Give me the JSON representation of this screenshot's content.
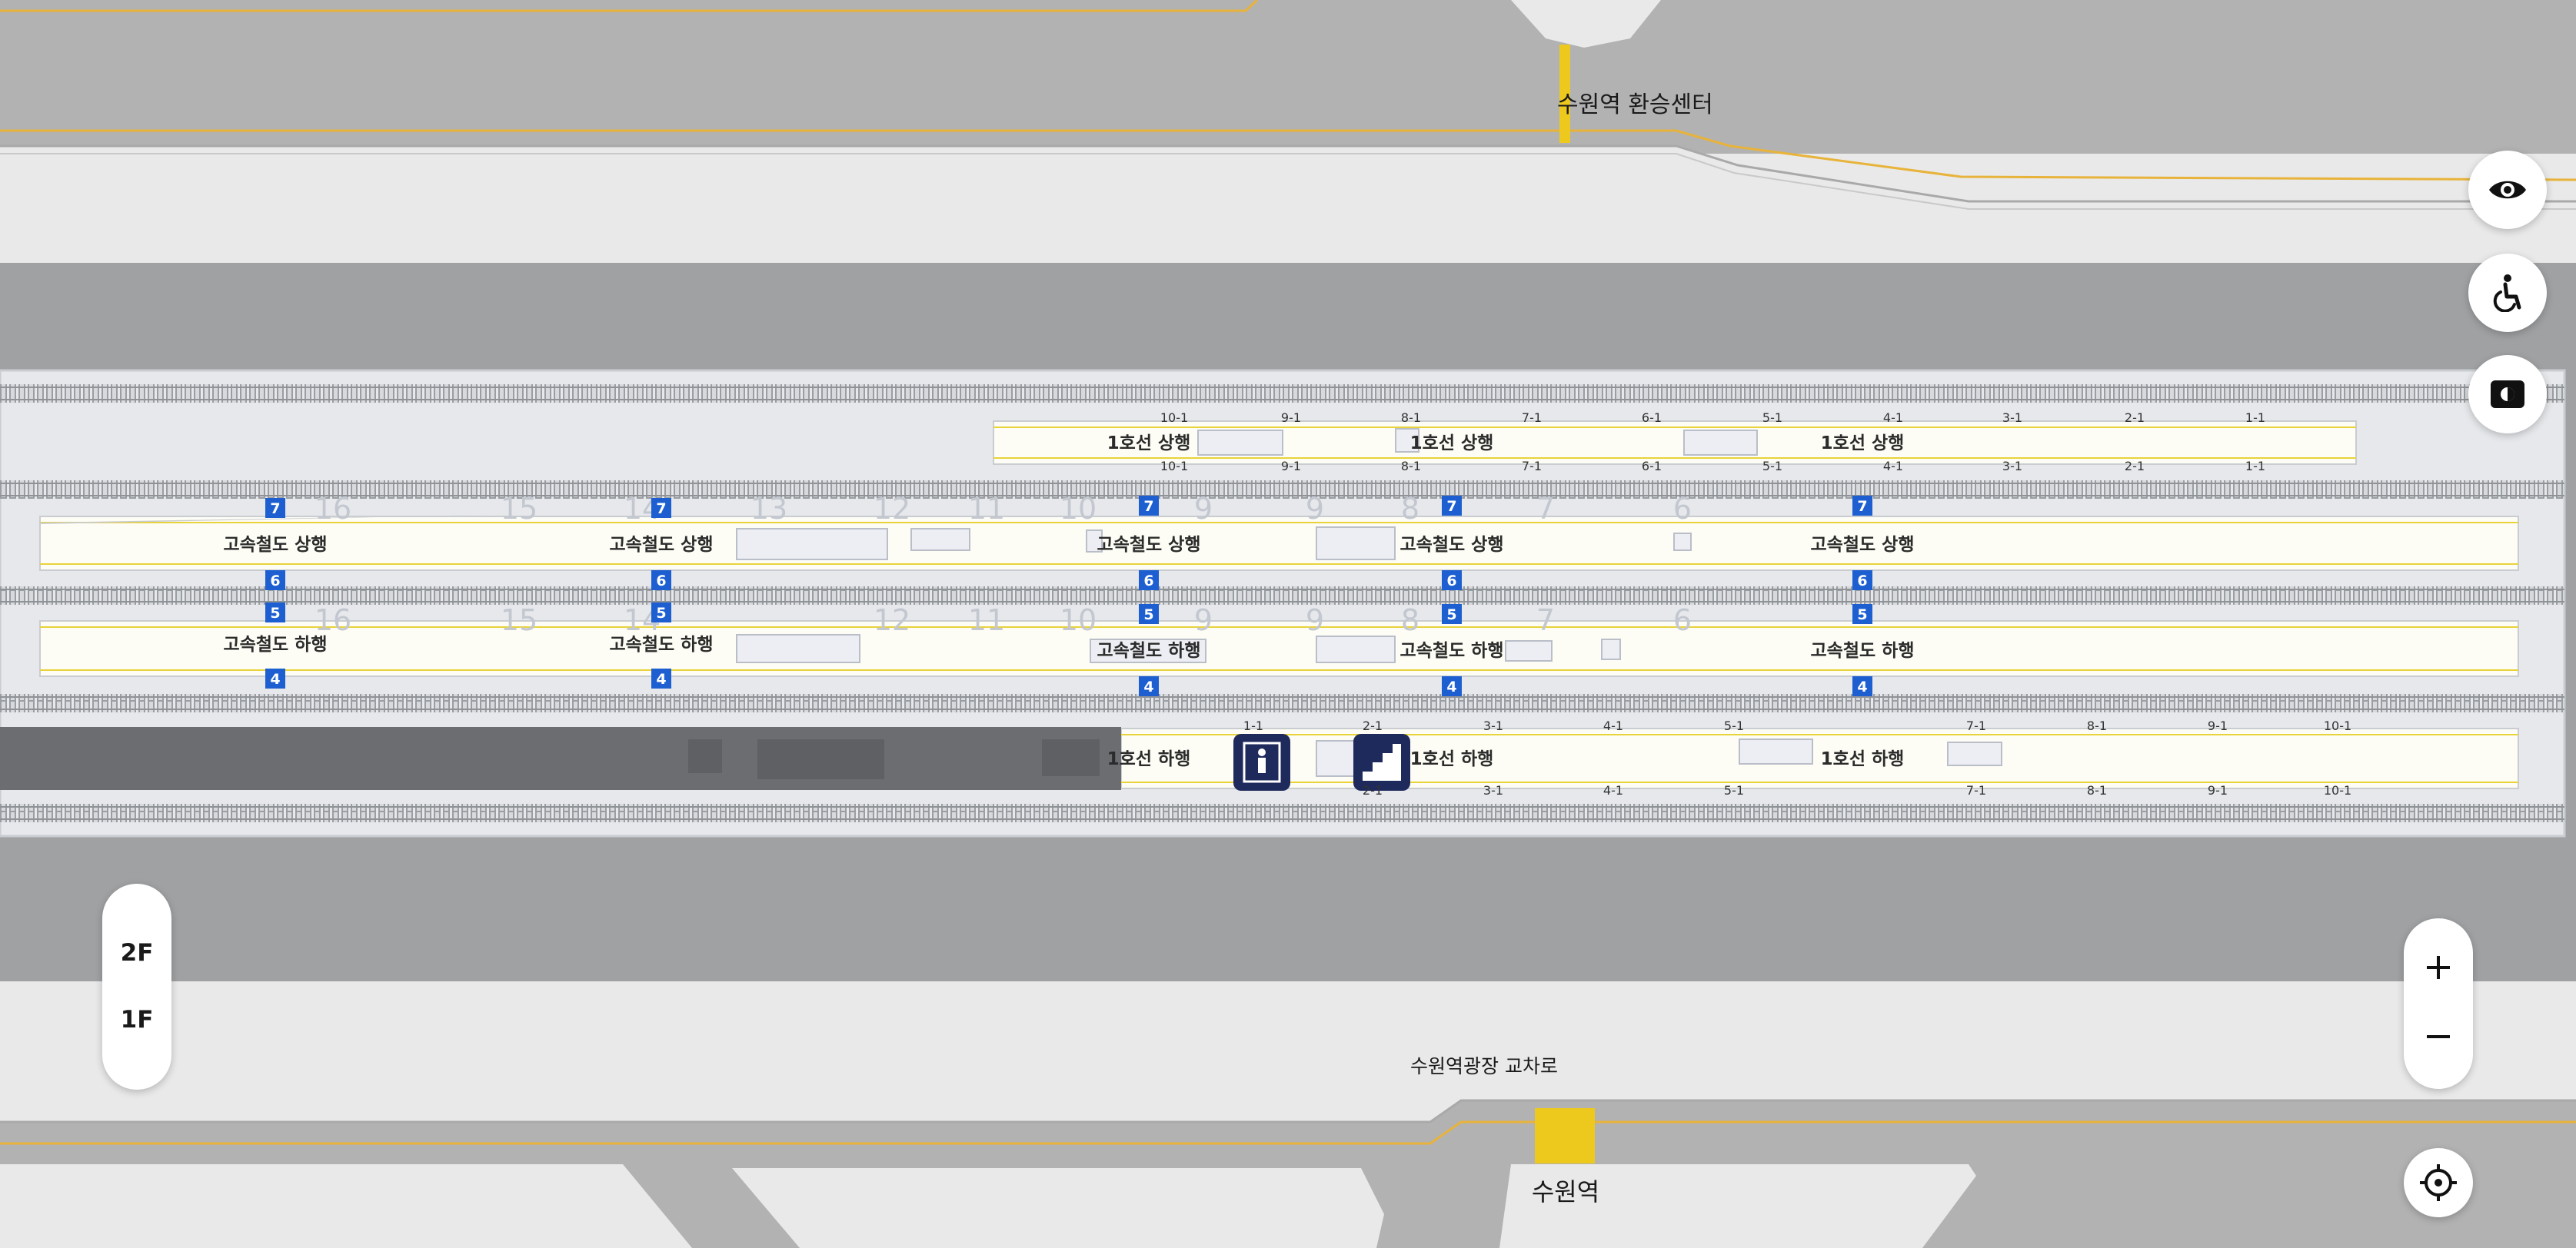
{
  "map": {
    "labels": {
      "transfer_center": "수원역 환승센터",
      "plaza_crossroad": "수원역광장 교차로",
      "station": "수원역"
    },
    "platforms": {
      "line1_up": "1호선 상행",
      "line1_down": "1호선 하행",
      "ktx_up": "고속철도 상행",
      "ktx_down": "고속철도 하행"
    },
    "car_numbers_top": [
      "10-1",
      "9-1",
      "8-1",
      "7-1",
      "6-1",
      "5-1",
      "4-1",
      "3-1",
      "2-1",
      "1-1"
    ],
    "car_numbers_bottom": [
      "1-1",
      "2-1",
      "3-1",
      "4-1",
      "5-1",
      "7-1",
      "8-1",
      "9-1",
      "10-1"
    ],
    "ktx_car_numbers": [
      "16",
      "15",
      "14",
      "13",
      "12",
      "11",
      "10",
      "9",
      "9",
      "8",
      "7",
      "6"
    ],
    "ktx_car_numbers_lower": [
      "16",
      "15",
      "14",
      "12",
      "11",
      "10",
      "9",
      "9",
      "8",
      "7",
      "6"
    ],
    "exit_badges": [
      "7",
      "6",
      "5",
      "4"
    ],
    "colors": {
      "road": "#b2b2b2",
      "sidewalk": "#e9e9e9",
      "block": "#9fa1a3",
      "platform_fill": "#fdfdf5",
      "platform_stripe": "#e8d33a",
      "badge": "#1d5fd1",
      "poi": "#1f2a5c",
      "crosswalk": "#ecc91c"
    }
  },
  "controls": {
    "view_icon": "eye-icon",
    "accessibility_icon": "wheelchair-icon",
    "layer_icon": "layer-toggle-icon",
    "floors": [
      "2F",
      "1F"
    ],
    "selected_floor": "1F",
    "zoom_in": "+",
    "zoom_out": "−",
    "locate_icon": "crosshair-icon"
  }
}
